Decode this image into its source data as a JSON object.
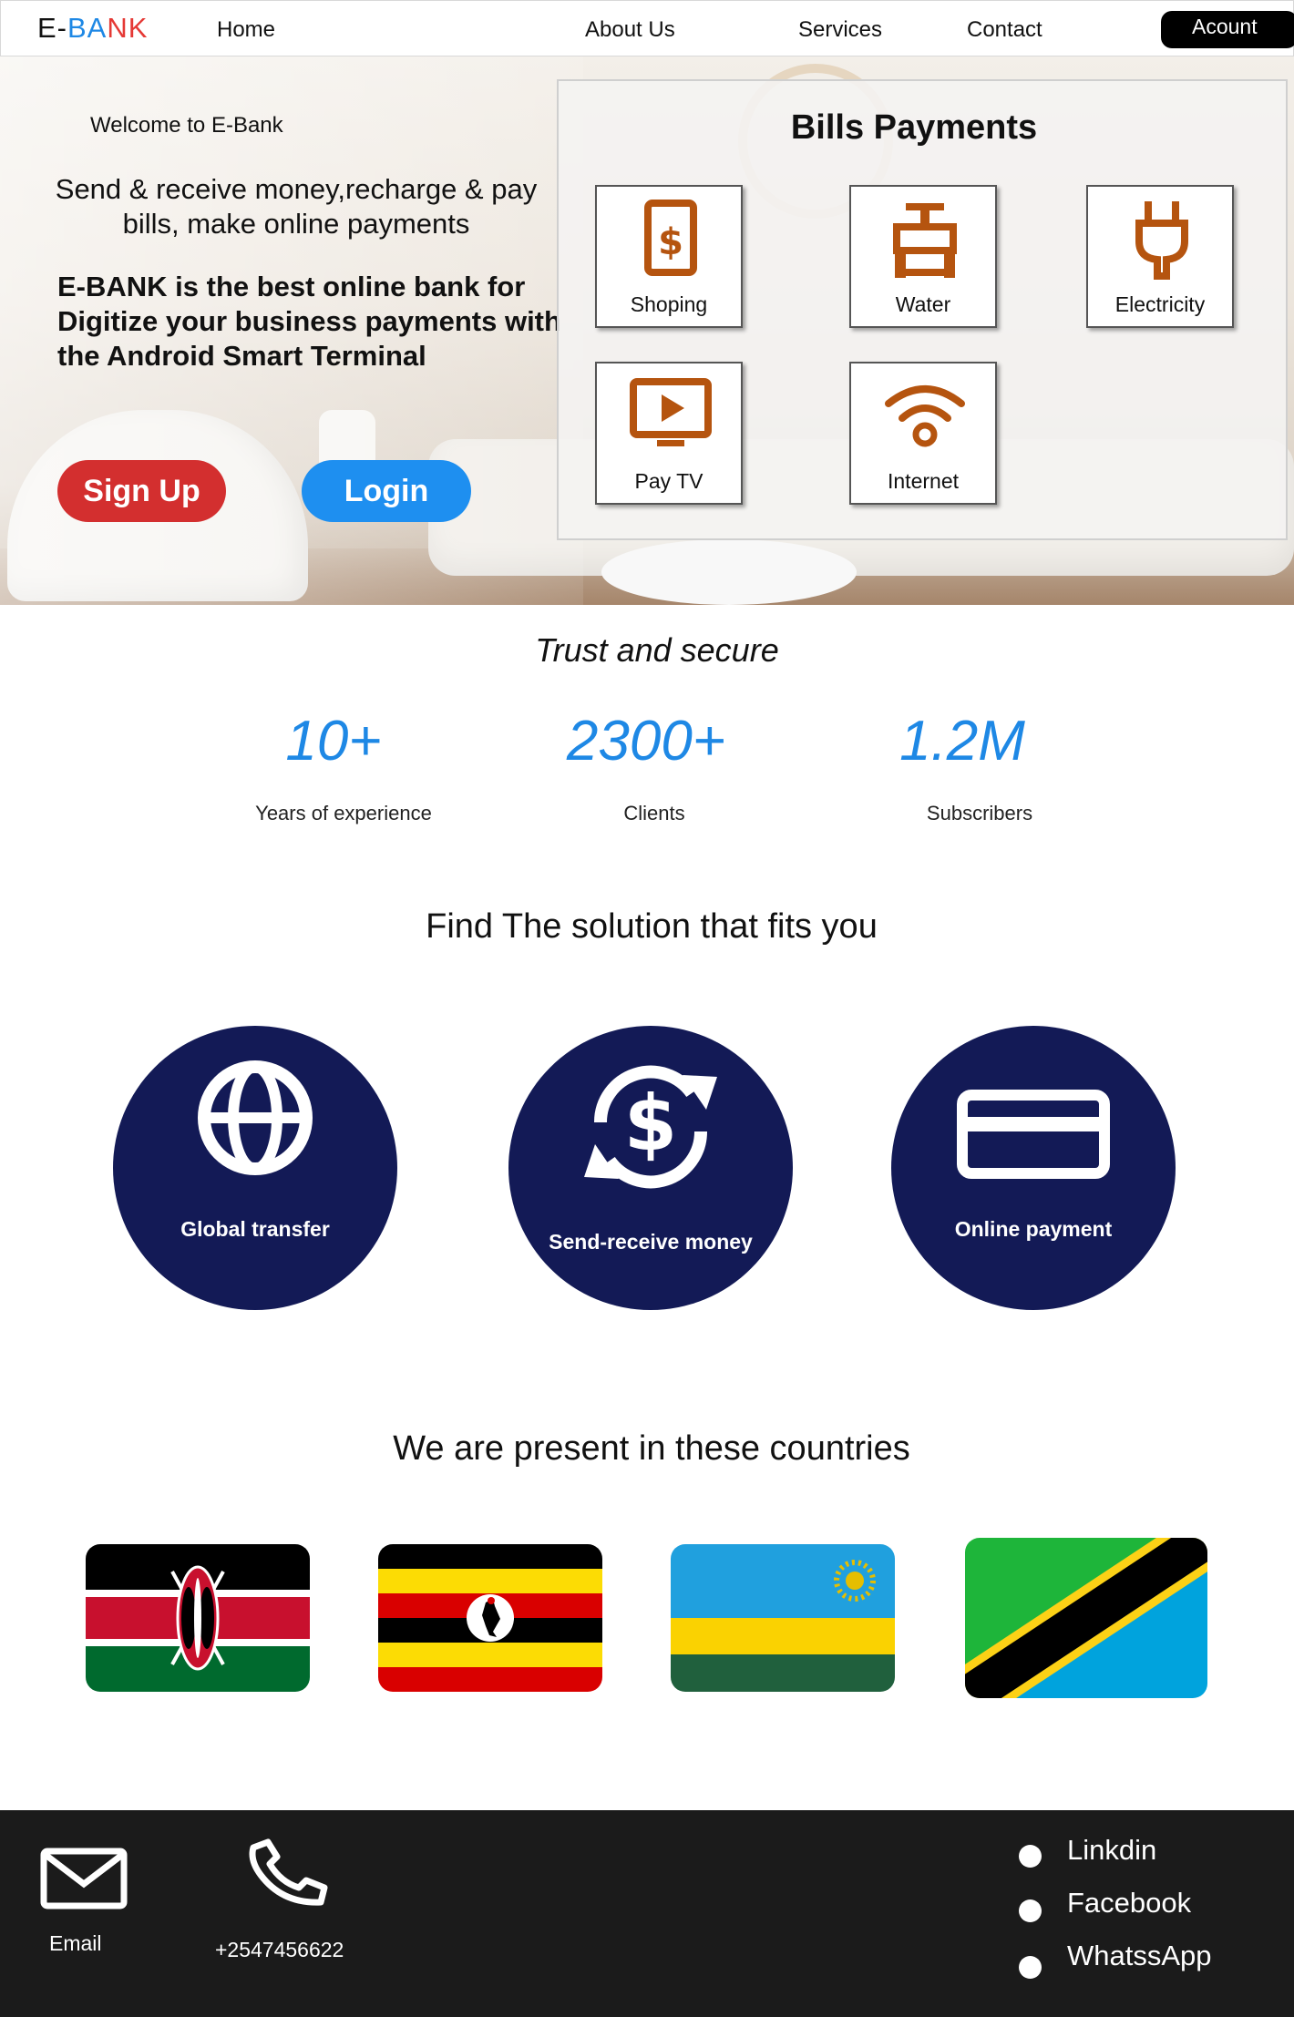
{
  "nav": {
    "logo_part1": "E-",
    "logo_part2": "BA",
    "logo_part3": "NK",
    "home": "Home",
    "about": "About Us",
    "services": "Services",
    "contact": "Contact",
    "account": "Acount"
  },
  "hero": {
    "welcome": "Welcome to E-Bank",
    "tagline": "Send & receive money,recharge & pay bills,  make online payments",
    "description": "E-BANK is the best online bank for Digitize your business payments with the Android Smart Terminal",
    "signup": "Sign Up",
    "login": "Login"
  },
  "bills": {
    "title": "Bills Payments",
    "items": [
      {
        "label": "Shoping",
        "icon": "dollar-bill-icon"
      },
      {
        "label": "Water",
        "icon": "water-tap-icon"
      },
      {
        "label": "Electricity",
        "icon": "plug-icon"
      },
      {
        "label": "Pay TV",
        "icon": "tv-play-icon"
      },
      {
        "label": "Internet",
        "icon": "wifi-icon"
      }
    ],
    "icon_color": "#b5540f"
  },
  "stats": {
    "title": "Trust and secure",
    "items": [
      {
        "value": "10+",
        "label": "Years of experience"
      },
      {
        "value": "2300+",
        "label": "Clients"
      },
      {
        "value": "1.2M",
        "label": "Subscribers"
      }
    ]
  },
  "solutions": {
    "title": "Find The solution that fits you",
    "items": [
      {
        "label": "Global transfer",
        "icon": "globe-icon"
      },
      {
        "label": "Send-receive money",
        "icon": "money-exchange-icon"
      },
      {
        "label": "Online payment",
        "icon": "credit-card-icon"
      }
    ]
  },
  "countries": {
    "title": "We are present in these countries",
    "flags": [
      "kenya-flag",
      "uganda-flag",
      "rwanda-flag",
      "tanzania-flag"
    ]
  },
  "footer": {
    "email_label": "Email",
    "phone": "+2547456622",
    "social": [
      "Linkdin",
      "Facebook",
      "WhatssApp"
    ]
  },
  "colors": {
    "accent_blue": "#1e88e5",
    "signup_red": "#d32f2f",
    "circle_navy": "#131a56",
    "footer_bg": "#1b1b1b"
  }
}
